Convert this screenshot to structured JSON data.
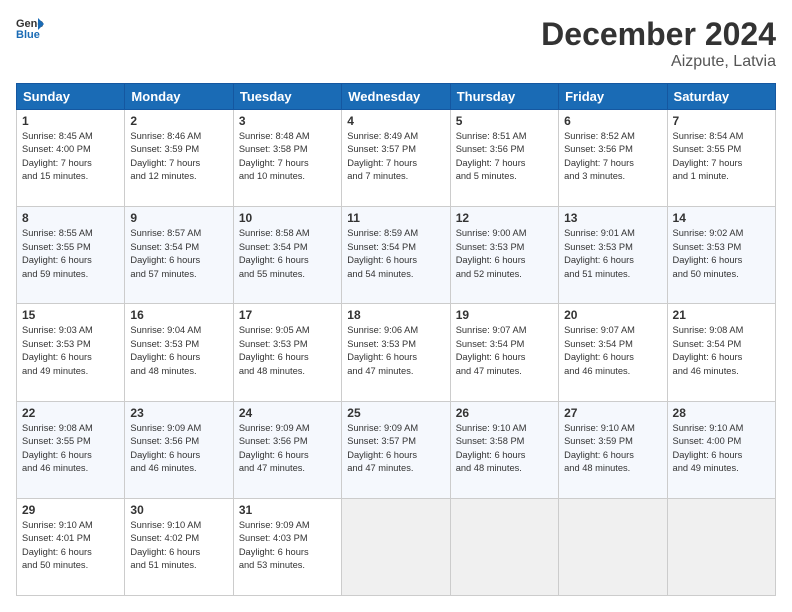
{
  "header": {
    "logo": {
      "line1": "General",
      "line2": "Blue"
    },
    "title": "December 2024",
    "subtitle": "Aizpute, Latvia"
  },
  "weekdays": [
    "Sunday",
    "Monday",
    "Tuesday",
    "Wednesday",
    "Thursday",
    "Friday",
    "Saturday"
  ],
  "weeks": [
    [
      {
        "day": "1",
        "info": "Sunrise: 8:45 AM\nSunset: 4:00 PM\nDaylight: 7 hours\nand 15 minutes."
      },
      {
        "day": "2",
        "info": "Sunrise: 8:46 AM\nSunset: 3:59 PM\nDaylight: 7 hours\nand 12 minutes."
      },
      {
        "day": "3",
        "info": "Sunrise: 8:48 AM\nSunset: 3:58 PM\nDaylight: 7 hours\nand 10 minutes."
      },
      {
        "day": "4",
        "info": "Sunrise: 8:49 AM\nSunset: 3:57 PM\nDaylight: 7 hours\nand 7 minutes."
      },
      {
        "day": "5",
        "info": "Sunrise: 8:51 AM\nSunset: 3:56 PM\nDaylight: 7 hours\nand 5 minutes."
      },
      {
        "day": "6",
        "info": "Sunrise: 8:52 AM\nSunset: 3:56 PM\nDaylight: 7 hours\nand 3 minutes."
      },
      {
        "day": "7",
        "info": "Sunrise: 8:54 AM\nSunset: 3:55 PM\nDaylight: 7 hours\nand 1 minute."
      }
    ],
    [
      {
        "day": "8",
        "info": "Sunrise: 8:55 AM\nSunset: 3:55 PM\nDaylight: 6 hours\nand 59 minutes."
      },
      {
        "day": "9",
        "info": "Sunrise: 8:57 AM\nSunset: 3:54 PM\nDaylight: 6 hours\nand 57 minutes."
      },
      {
        "day": "10",
        "info": "Sunrise: 8:58 AM\nSunset: 3:54 PM\nDaylight: 6 hours\nand 55 minutes."
      },
      {
        "day": "11",
        "info": "Sunrise: 8:59 AM\nSunset: 3:54 PM\nDaylight: 6 hours\nand 54 minutes."
      },
      {
        "day": "12",
        "info": "Sunrise: 9:00 AM\nSunset: 3:53 PM\nDaylight: 6 hours\nand 52 minutes."
      },
      {
        "day": "13",
        "info": "Sunrise: 9:01 AM\nSunset: 3:53 PM\nDaylight: 6 hours\nand 51 minutes."
      },
      {
        "day": "14",
        "info": "Sunrise: 9:02 AM\nSunset: 3:53 PM\nDaylight: 6 hours\nand 50 minutes."
      }
    ],
    [
      {
        "day": "15",
        "info": "Sunrise: 9:03 AM\nSunset: 3:53 PM\nDaylight: 6 hours\nand 49 minutes."
      },
      {
        "day": "16",
        "info": "Sunrise: 9:04 AM\nSunset: 3:53 PM\nDaylight: 6 hours\nand 48 minutes."
      },
      {
        "day": "17",
        "info": "Sunrise: 9:05 AM\nSunset: 3:53 PM\nDaylight: 6 hours\nand 48 minutes."
      },
      {
        "day": "18",
        "info": "Sunrise: 9:06 AM\nSunset: 3:53 PM\nDaylight: 6 hours\nand 47 minutes."
      },
      {
        "day": "19",
        "info": "Sunrise: 9:07 AM\nSunset: 3:54 PM\nDaylight: 6 hours\nand 47 minutes."
      },
      {
        "day": "20",
        "info": "Sunrise: 9:07 AM\nSunset: 3:54 PM\nDaylight: 6 hours\nand 46 minutes."
      },
      {
        "day": "21",
        "info": "Sunrise: 9:08 AM\nSunset: 3:54 PM\nDaylight: 6 hours\nand 46 minutes."
      }
    ],
    [
      {
        "day": "22",
        "info": "Sunrise: 9:08 AM\nSunset: 3:55 PM\nDaylight: 6 hours\nand 46 minutes."
      },
      {
        "day": "23",
        "info": "Sunrise: 9:09 AM\nSunset: 3:56 PM\nDaylight: 6 hours\nand 46 minutes."
      },
      {
        "day": "24",
        "info": "Sunrise: 9:09 AM\nSunset: 3:56 PM\nDaylight: 6 hours\nand 47 minutes."
      },
      {
        "day": "25",
        "info": "Sunrise: 9:09 AM\nSunset: 3:57 PM\nDaylight: 6 hours\nand 47 minutes."
      },
      {
        "day": "26",
        "info": "Sunrise: 9:10 AM\nSunset: 3:58 PM\nDaylight: 6 hours\nand 48 minutes."
      },
      {
        "day": "27",
        "info": "Sunrise: 9:10 AM\nSunset: 3:59 PM\nDaylight: 6 hours\nand 48 minutes."
      },
      {
        "day": "28",
        "info": "Sunrise: 9:10 AM\nSunset: 4:00 PM\nDaylight: 6 hours\nand 49 minutes."
      }
    ],
    [
      {
        "day": "29",
        "info": "Sunrise: 9:10 AM\nSunset: 4:01 PM\nDaylight: 6 hours\nand 50 minutes."
      },
      {
        "day": "30",
        "info": "Sunrise: 9:10 AM\nSunset: 4:02 PM\nDaylight: 6 hours\nand 51 minutes."
      },
      {
        "day": "31",
        "info": "Sunrise: 9:09 AM\nSunset: 4:03 PM\nDaylight: 6 hours\nand 53 minutes."
      },
      null,
      null,
      null,
      null
    ]
  ]
}
